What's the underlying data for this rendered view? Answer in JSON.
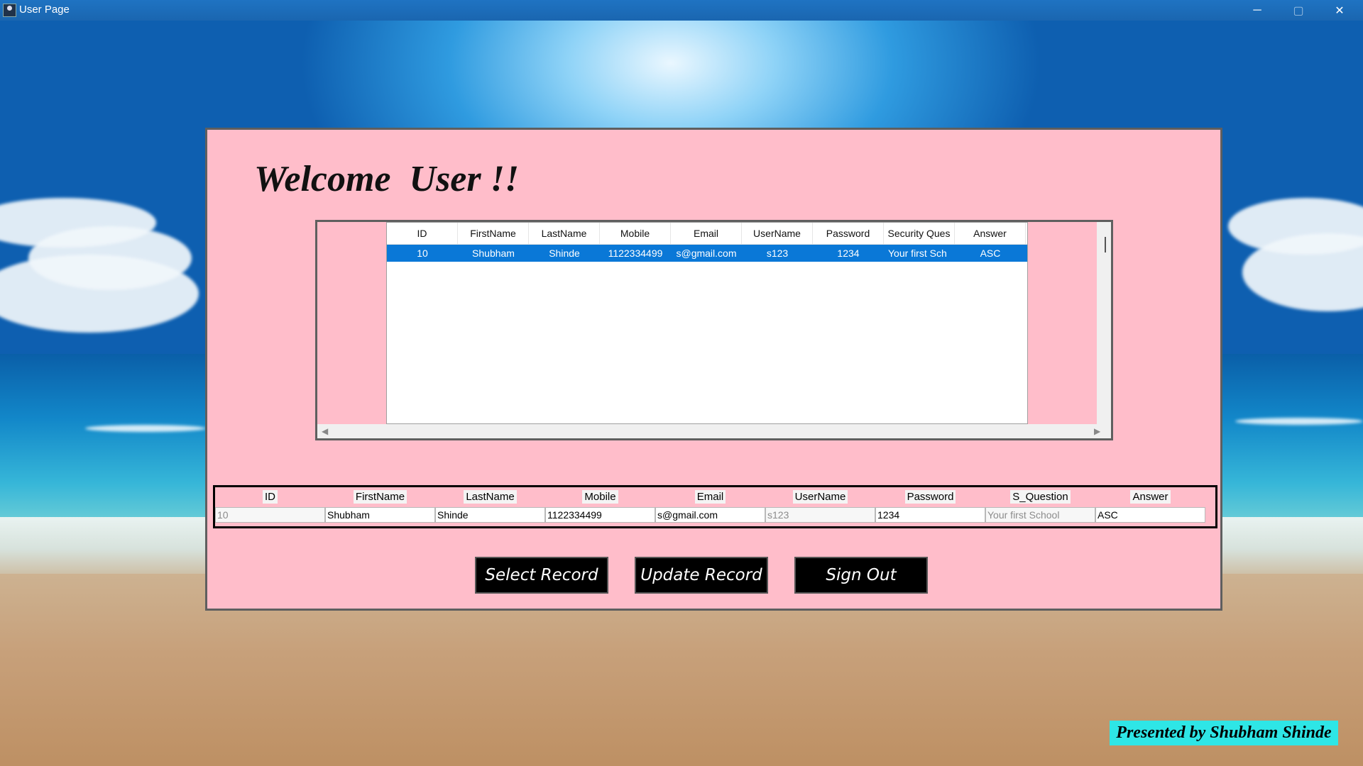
{
  "window": {
    "title": "User Page",
    "minimize_glyph": "─",
    "maximize_glyph": "▢",
    "close_glyph": "✕"
  },
  "welcome_text": "Welcome  User !!",
  "grid": {
    "columns": [
      "ID",
      "FirstName",
      "LastName",
      "Mobile",
      "Email",
      "UserName",
      "Password",
      "Security Ques",
      "Answer"
    ],
    "rows": [
      [
        "10",
        "Shubham",
        "Shinde",
        "1122334499",
        "s@gmail.com",
        "s123",
        "1234",
        "Your first Sch",
        "ASC"
      ]
    ],
    "selected_row_color": "#0a78d7"
  },
  "form": {
    "fields": [
      {
        "label": "ID",
        "value": "10"
      },
      {
        "label": "FirstName",
        "value": "Shubham"
      },
      {
        "label": "LastName",
        "value": "Shinde"
      },
      {
        "label": "Mobile",
        "value": "1122334499"
      },
      {
        "label": "Email",
        "value": "s@gmail.com"
      },
      {
        "label": "UserName",
        "value": "s123"
      },
      {
        "label": "Password",
        "value": "1234"
      },
      {
        "label": "S_Question",
        "value": "Your first School"
      },
      {
        "label": "Answer",
        "value": "ASC"
      }
    ]
  },
  "buttons": {
    "select": "Select Record",
    "update": "Update Record",
    "signout": "Sign Out"
  },
  "credit": "Presented by Shubham Shinde",
  "colors": {
    "panel_bg": "#ffbdca",
    "credit_bg": "#2ee6e6",
    "button_bg": "#000000"
  }
}
